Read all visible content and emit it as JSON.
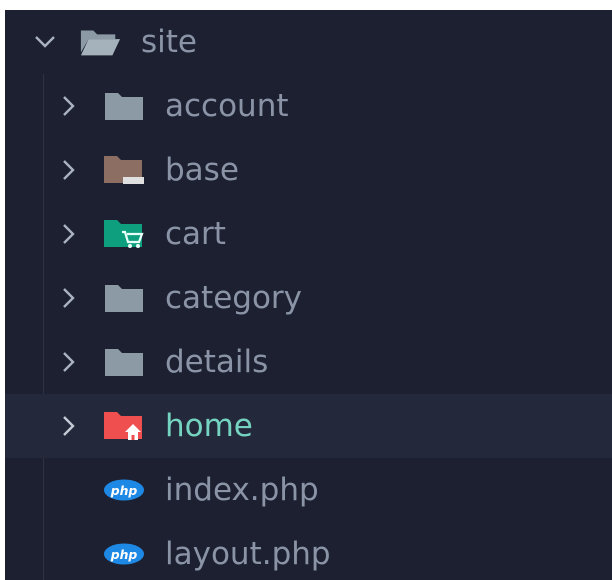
{
  "tree": {
    "root": {
      "label": "site",
      "expanded": true,
      "icon": "folder-open-icon"
    },
    "items": [
      {
        "label": "account",
        "type": "folder",
        "icon": "folder-icon",
        "color": "#8b9aa5"
      },
      {
        "label": "base",
        "type": "folder",
        "icon": "folder-base-icon",
        "color": "#8d6e63"
      },
      {
        "label": "cart",
        "type": "folder",
        "icon": "folder-cart-icon",
        "color": "#0e9f7e"
      },
      {
        "label": "category",
        "type": "folder",
        "icon": "folder-icon",
        "color": "#8b9aa5"
      },
      {
        "label": "details",
        "type": "folder",
        "icon": "folder-icon",
        "color": "#8b9aa5"
      },
      {
        "label": "home",
        "type": "folder",
        "icon": "folder-home-icon",
        "color": "#ef4f4f",
        "selected": true
      },
      {
        "label": "index.php",
        "type": "file",
        "icon": "php-icon",
        "color": "#1e88e5"
      },
      {
        "label": "layout.php",
        "type": "file",
        "icon": "php-icon",
        "color": "#1e88e5"
      }
    ]
  }
}
